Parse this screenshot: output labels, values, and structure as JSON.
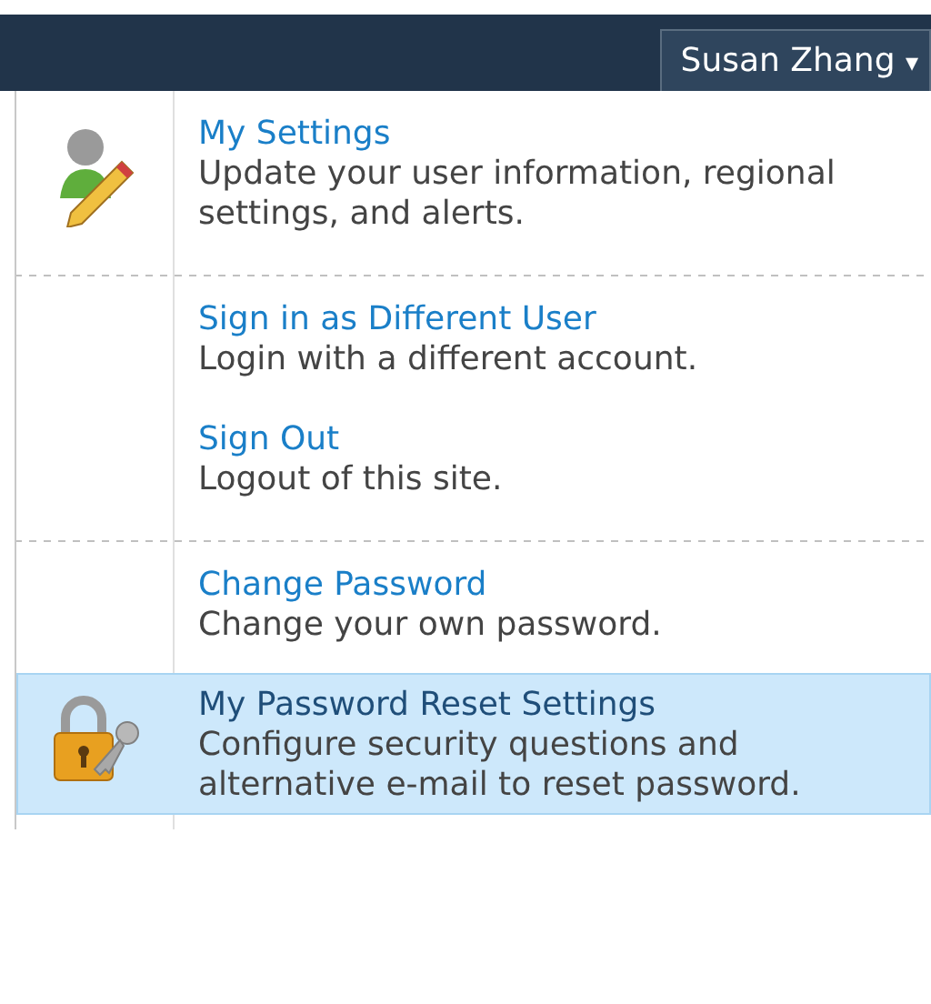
{
  "header": {
    "user_menu": {
      "label": "Susan Zhang",
      "caret": "▾"
    }
  },
  "menu": {
    "groups": [
      {
        "items": [
          {
            "kind": "user-settings",
            "title": "My Settings",
            "description": "Update your user information, regional settings, and alerts.",
            "highlighted": false
          }
        ]
      },
      {
        "items": [
          {
            "kind": "plain",
            "title": "Sign in as Different User",
            "description": "Login with a different account.",
            "highlighted": false
          },
          {
            "kind": "plain",
            "title": "Sign Out",
            "description": "Logout of this site.",
            "highlighted": false
          }
        ]
      },
      {
        "items": [
          {
            "kind": "plain",
            "title": "Change Password",
            "description": "Change your own password.",
            "highlighted": false
          },
          {
            "kind": "password-reset",
            "title": "My Password Reset Settings",
            "description": "Configure security questions and alternative e-mail to reset password.",
            "highlighted": true
          }
        ]
      }
    ]
  }
}
